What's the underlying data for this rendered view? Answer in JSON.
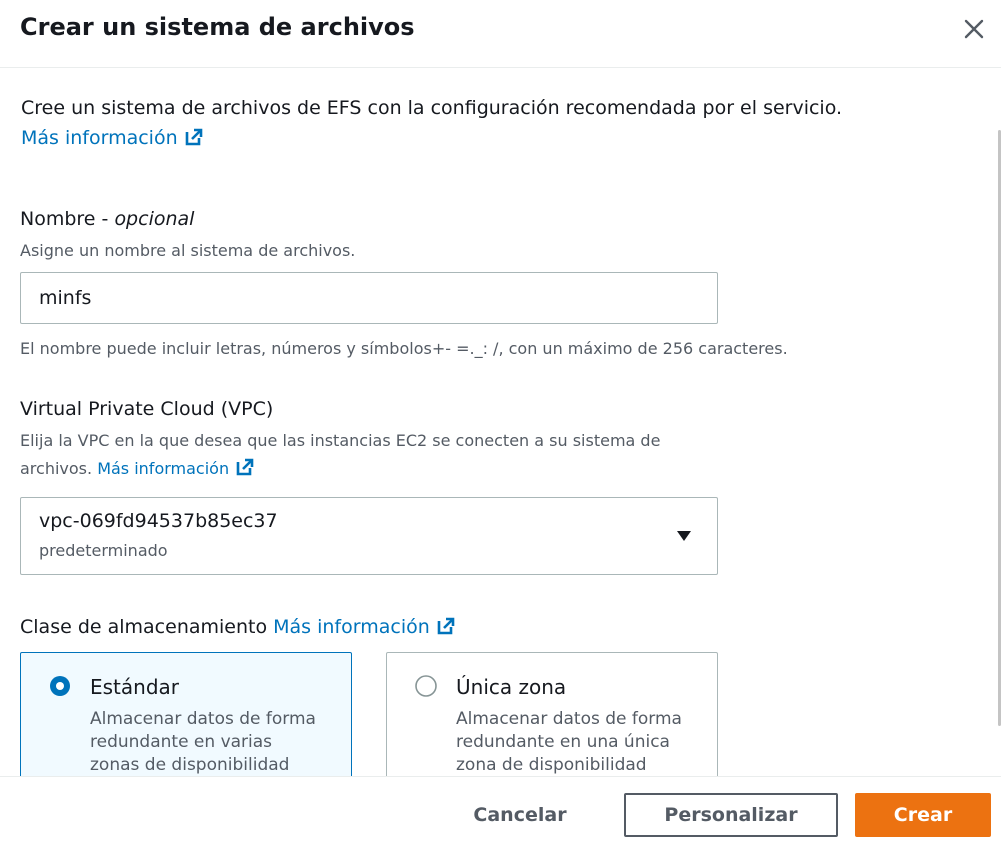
{
  "modal": {
    "title": "Crear un sistema de archivos",
    "intro_text": "Cree un sistema de archivos de EFS con la configuración recomendada por el servicio.",
    "learn_more": "Más información"
  },
  "name_field": {
    "label": "Nombre - ",
    "label_optional": "opcional",
    "description": "Asigne un nombre al sistema de archivos.",
    "value": "minfs",
    "constraint": "El nombre puede incluir letras, números y símbolos+- =._: /, con un máximo de 256 caracteres."
  },
  "vpc_field": {
    "label": "Virtual Private Cloud (VPC)",
    "description_line1": "Elija la VPC en la que desea que las instancias EC2 se conecten a su sistema de",
    "description_line2": "archivos.",
    "learn_more": "Más información",
    "selected_value": "vpc-069fd94537b85ec37",
    "selected_sub": "predeterminado"
  },
  "storage_class": {
    "label": "Clase de almacenamiento",
    "learn_more": "Más información",
    "options": [
      {
        "title": "Estándar",
        "description": "Almacenar datos de forma redundante en varias zonas de disponibilidad",
        "selected": true
      },
      {
        "title": "Única zona",
        "description": "Almacenar datos de forma redundante en una única zona de disponibilidad",
        "selected": false
      }
    ]
  },
  "footer": {
    "cancel_label": "Cancelar",
    "customize_label": "Personalizar",
    "create_label": "Crear"
  },
  "icons": {
    "close": "close-icon",
    "external_link": "external-link-icon",
    "caret": "caret-down-icon",
    "radio_selected": "radio-selected-icon",
    "radio_unselected": "radio-unselected-icon"
  },
  "colors": {
    "link": "#0073bb",
    "primary_button": "#ec7211",
    "selected_tile_bg": "#f1faff",
    "selected_tile_border": "#0073bb",
    "text": "#16191f",
    "secondary_text": "#545b64"
  }
}
